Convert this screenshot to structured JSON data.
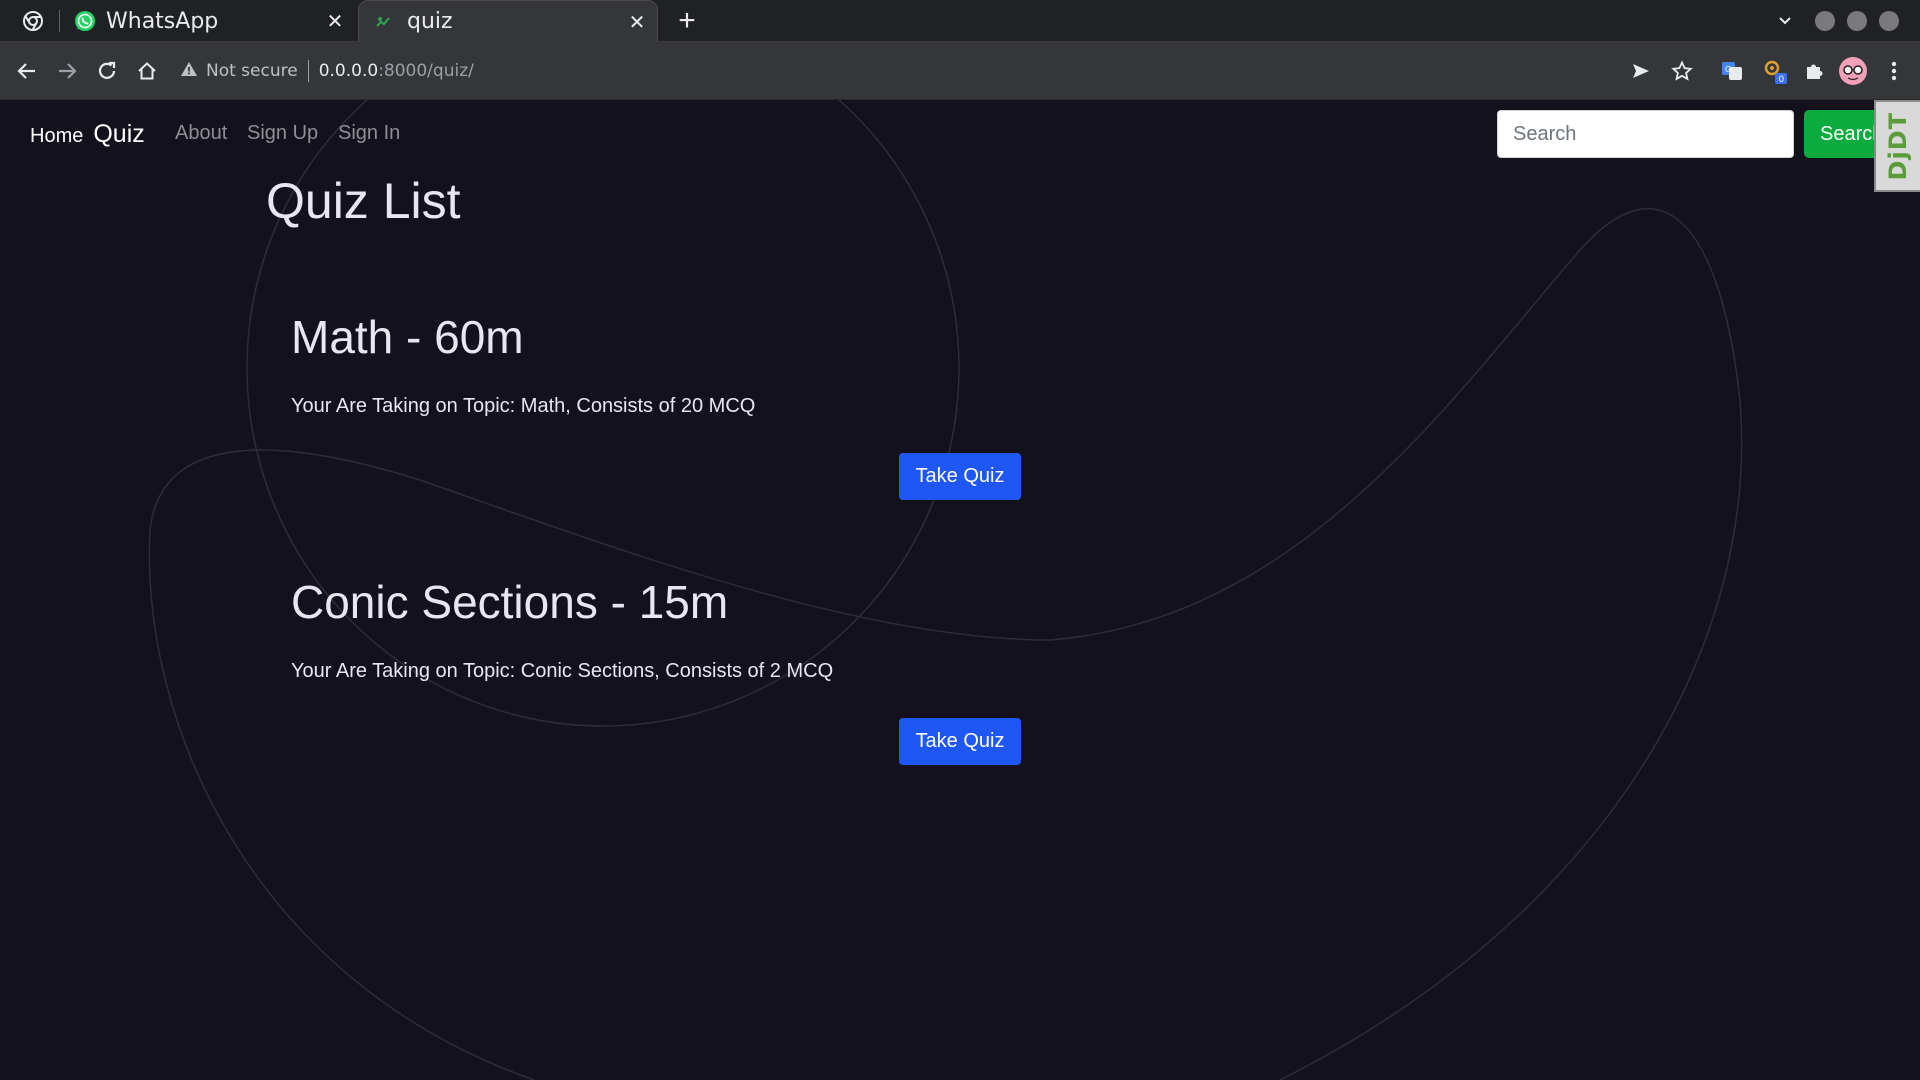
{
  "browser": {
    "tabs": [
      {
        "title": "WhatsApp",
        "active": false,
        "icon": "whatsapp-icon"
      },
      {
        "title": "quiz",
        "active": true,
        "icon": "quiz-favicon"
      }
    ],
    "address_bar": {
      "security_label": "Not secure",
      "url_host": "0.0.0.0",
      "url_rest": ":8000/quiz/"
    },
    "extension_badge": "0"
  },
  "navbar": {
    "brand_home": "Home",
    "brand_quiz": "Quiz",
    "links": [
      "About",
      "Sign Up",
      "Sign In"
    ],
    "search_placeholder": "Search",
    "search_button": "Search",
    "debug_toolbar_label": "DjDT"
  },
  "main": {
    "title": "Quiz List",
    "quizzes": [
      {
        "heading": "Math - 60m",
        "description": "Your Are Taking on Topic: Math, Consists of 20 MCQ",
        "button": "Take Quiz"
      },
      {
        "heading": "Conic Sections - 15m",
        "description": "Your Are Taking on Topic: Conic Sections, Consists of 2 MCQ",
        "button": "Take Quiz"
      }
    ]
  },
  "colors": {
    "page_background": "#13111b",
    "primary_button": "#1f57f5",
    "search_button": "#0bab3e",
    "heading_text": "#e8e6f0"
  }
}
